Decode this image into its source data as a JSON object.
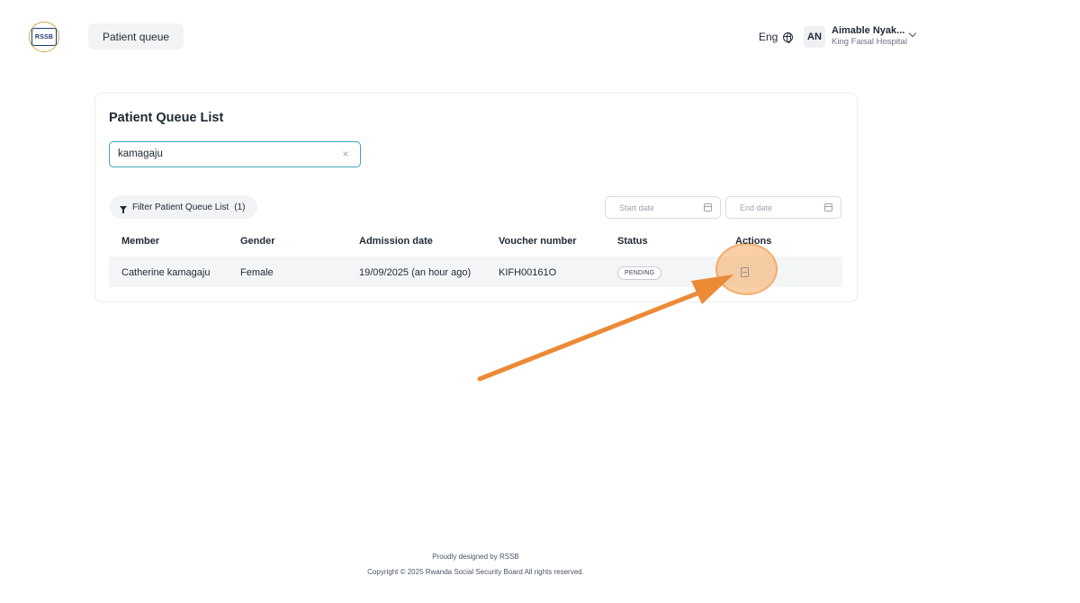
{
  "header": {
    "logo_text": "RSSB",
    "nav_tab": "Patient queue",
    "language": "Eng",
    "globe_icon": "globe-icon",
    "user": {
      "initials": "AN",
      "name": "Aimable Nyak...",
      "organization": "King Faisal Hospital"
    }
  },
  "main": {
    "title": "Patient Queue List",
    "search": {
      "value": "kamagaju",
      "clear_icon": "×"
    },
    "filter_button": {
      "label": "Filter Patient Queue List",
      "count": "(1)"
    },
    "start_date": {
      "placeholder": "Start date"
    },
    "end_date": {
      "placeholder": "End date"
    },
    "table": {
      "columns": [
        "Member",
        "Gender",
        "Admission date",
        "Voucher number",
        "Status",
        "Actions"
      ],
      "rows": [
        {
          "member": "Catherine kamagaju",
          "gender": "Female",
          "admission_date": "19/09/2025 (an hour ago)",
          "voucher_number": "KIFH00161O",
          "status": "PENDING",
          "action_icon": "document-icon"
        }
      ]
    }
  },
  "annotation": {
    "highlight_color": "#f5a85f",
    "arrow_color": "#ec8a35"
  },
  "footer": {
    "line1": "Proudly designed by RSSB",
    "line2": "Copyright © 2025 Rwanda Social Security Board All rights reserved."
  }
}
